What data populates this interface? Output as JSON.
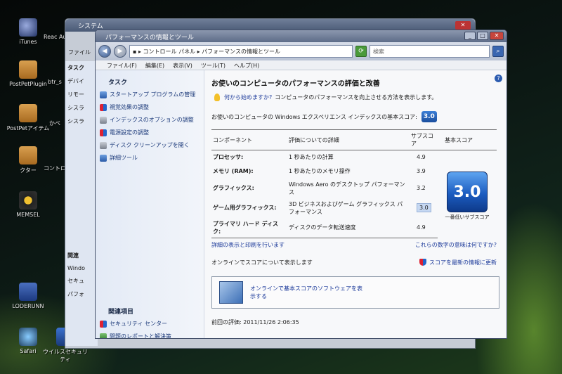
{
  "desktop": {
    "icons": [
      {
        "label": "iTunes"
      },
      {
        "label": "PostPetPlugin"
      },
      {
        "label": "PostPetアイテム"
      },
      {
        "label": "クター"
      },
      {
        "label": "MEMSEL"
      },
      {
        "label": "LODERUNN"
      },
      {
        "label": "Safari"
      },
      {
        "label": "ウイルスセキュリティ"
      },
      {
        "label": "Reac Auto"
      },
      {
        "label": "btr_s"
      },
      {
        "label": "かべ"
      },
      {
        "label": "コントロ"
      }
    ]
  },
  "back_window": {
    "title": "システム",
    "side_head": "タスク",
    "items": [
      "デバイ",
      "リモー",
      "シスラ",
      "シスラ"
    ],
    "related_head": "関連",
    "related_items": [
      "Windo",
      "セキュ",
      "パフォ"
    ],
    "menu_label": "ファイル"
  },
  "window": {
    "title": "パフォーマンスの情報とツール",
    "address": "▪ ▸ コントロール パネル ▸ パフォーマンスの情報とツール",
    "search_placeholder": "検索",
    "menu": [
      "ファイル(F)",
      "編集(E)",
      "表示(V)",
      "ツール(T)",
      "ヘルプ(H)"
    ],
    "sidebar": {
      "task_head": "タスク",
      "tasks": [
        "スタートアップ プログラムの管理",
        "視覚効果の調整",
        "インデックスのオプションの調整",
        "電源設定の調整",
        "ディスク クリーンアップを開く",
        "詳細ツール"
      ],
      "related_head": "関連項目",
      "related": [
        "セキュリティ センター",
        "問題のレポートと解決策"
      ]
    },
    "main": {
      "title": "お使いのコンピュータのパフォーマンスの評価と改善",
      "hint_link": "何から始めますか?",
      "hint_text": "コンピュータのパフォーマンスを向上させる方法を表示します。",
      "base_label": "お使いのコンピュータの Windows エクスペリエンス インデックスの基本スコア:",
      "base_score": "3.0",
      "table_headers": [
        "コンポーネント",
        "評価についての詳細",
        "サブスコア",
        "基本スコア"
      ],
      "rows": [
        {
          "component": "プロセッサ:",
          "detail": "1 秒あたりの計算",
          "subscore": "4.9"
        },
        {
          "component": "メモリ (RAM):",
          "detail": "1 秒あたりのメモリ操作",
          "subscore": "3.9"
        },
        {
          "component": "グラフィックス:",
          "detail": "Windows Aero のデスクトップ パフォーマンス",
          "subscore": "3.2"
        },
        {
          "component": "ゲーム用グラフィックス:",
          "detail": "3D ビジネスおよびゲーム グラフィックス パフォーマンス",
          "subscore": "3.0"
        },
        {
          "component": "プライマリ ハード ディスク:",
          "detail": "ディスクのデータ転送速度",
          "subscore": "4.9"
        }
      ],
      "big_score": "3.0",
      "big_caption": "一番低いサブスコア",
      "print_link": "詳細の表示と印刷を行います",
      "meaning_link": "これらの数字の意味は何ですか?",
      "online_text": "オンラインでスコアについて表示します",
      "refresh_link": "スコアを最新の情報に更新",
      "promo_text": "オンラインで基本スコアのソフトウェアを表示する",
      "last_eval": "前回の評価: 2011/11/26 2:06:35"
    }
  }
}
